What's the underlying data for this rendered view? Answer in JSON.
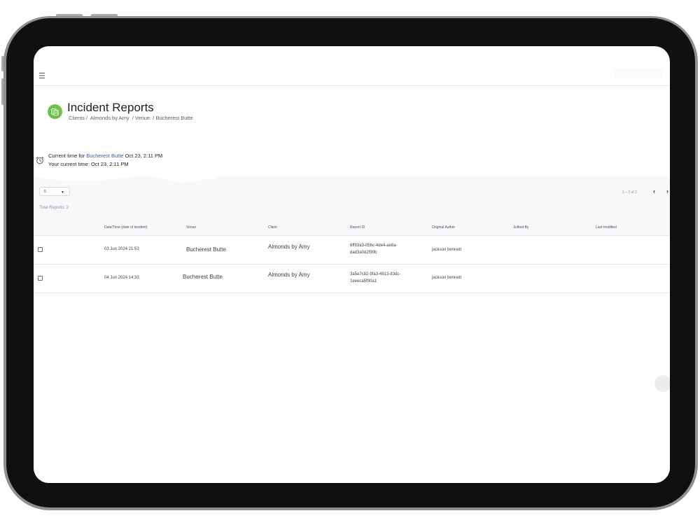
{
  "app": {
    "menu_icon": "hamburger-icon"
  },
  "page": {
    "title": "Incident Reports",
    "icon": "report-icon",
    "breadcrumb": [
      "Clients /",
      "Almonds by Amy",
      " / Venue",
      " / ",
      "Bucherest Butte"
    ]
  },
  "time_info": {
    "icon": "alarm-clock-icon",
    "venue_prefix": "Current time for",
    "venue_name": "Bucherest Butte",
    "venue_time": "Oct 23, 2:11 PM",
    "user_prefix": "Your current time:",
    "user_time": "Oct 23, 2:11 PM"
  },
  "table_controls": {
    "page_size": "5",
    "total_reports": "Total Reports: 2",
    "pagination_range": "1 – 2 of 2"
  },
  "table": {
    "columns": [
      "Date/Time (date of incident)",
      "Venue",
      "Client",
      "Report ID",
      "Original Author",
      "Edited By",
      "Last modified"
    ],
    "rows": [
      {
        "datetime": "03 Jun 2024 21:53",
        "venue": "Bucherest Butte",
        "client": "Almonds by Amy",
        "report_id_line1": "6ff93a3-056c-4de4-ae8a-",
        "report_id_line2": "dad3a0d2f90b",
        "author": "jackson bennett",
        "edited_by": "",
        "last_modified": ""
      },
      {
        "datetime": "04 Jun 2024 14:33",
        "venue": "Bucherest Butte",
        "client": "Almonds by Amy",
        "report_id_line1": "3a5e7c82-9fa3-4913-83dc-",
        "report_id_line2": "1eeeca5f90a1",
        "author": "jackson bennett",
        "edited_by": "",
        "last_modified": ""
      }
    ]
  },
  "colors": {
    "accent_green": "#6cc24a",
    "venue_link": "#3d5a9e",
    "device_frame": "#101012"
  }
}
